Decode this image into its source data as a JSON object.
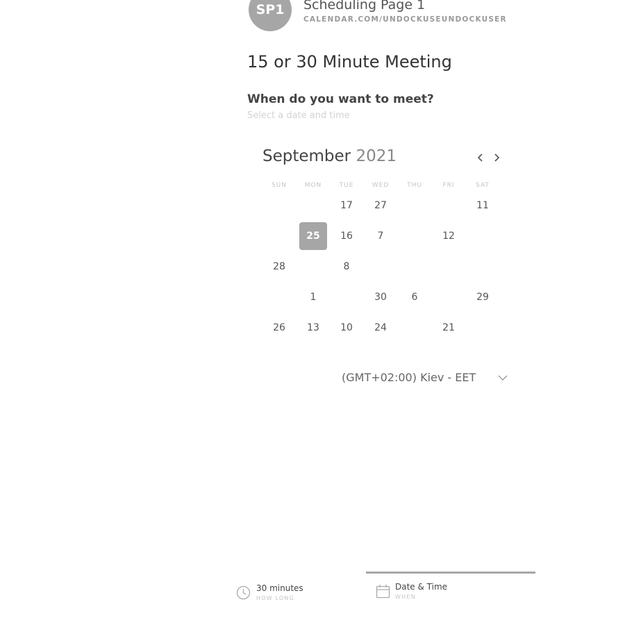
{
  "header": {
    "avatar_initials": "SP1",
    "page_name": "Scheduling Page 1",
    "page_url": "CALENDAR.COM/UNDOCKUSEUNDOCKUSER"
  },
  "meeting": {
    "title": "15 or 30 Minute Meeting",
    "question": "When do you want to meet?",
    "hint": "Select a date and time"
  },
  "calendar": {
    "month": "September",
    "year": "2021",
    "weekdays": [
      "SUN",
      "MON",
      "TUE",
      "WED",
      "THU",
      "FRI",
      "SAT"
    ],
    "days": [
      {
        "label": "17",
        "state": "available"
      },
      {
        "label": "27",
        "state": "available"
      },
      {
        "label": "11",
        "state": "available"
      },
      {
        "label": "25",
        "state": "selected"
      },
      {
        "label": "16",
        "state": "available"
      },
      {
        "label": "7",
        "state": "available"
      },
      {
        "label": "12",
        "state": "available"
      },
      {
        "label": "28",
        "state": "available"
      },
      {
        "label": "8",
        "state": "available"
      },
      {
        "label": "1",
        "state": "available"
      },
      {
        "label": "30",
        "state": "available"
      },
      {
        "label": "6",
        "state": "available"
      },
      {
        "label": "29",
        "state": "available"
      },
      {
        "label": "26",
        "state": "available"
      },
      {
        "label": "13",
        "state": "available"
      },
      {
        "label": "10",
        "state": "available"
      },
      {
        "label": "24",
        "state": "available"
      },
      {
        "label": "21",
        "state": "available"
      }
    ]
  },
  "timezone": {
    "value": "(GMT+02:00) Kiev - EET"
  },
  "steps": [
    {
      "label": "30 minutes",
      "sub": "HOW LONG",
      "icon": "clock-icon"
    },
    {
      "label": "Date & Time",
      "sub": "WHEN",
      "icon": "calendar-icon",
      "active": true
    }
  ],
  "colors": {
    "accent": "#a6a6a6",
    "text": "#333333",
    "muted": "#c4c4c4"
  }
}
